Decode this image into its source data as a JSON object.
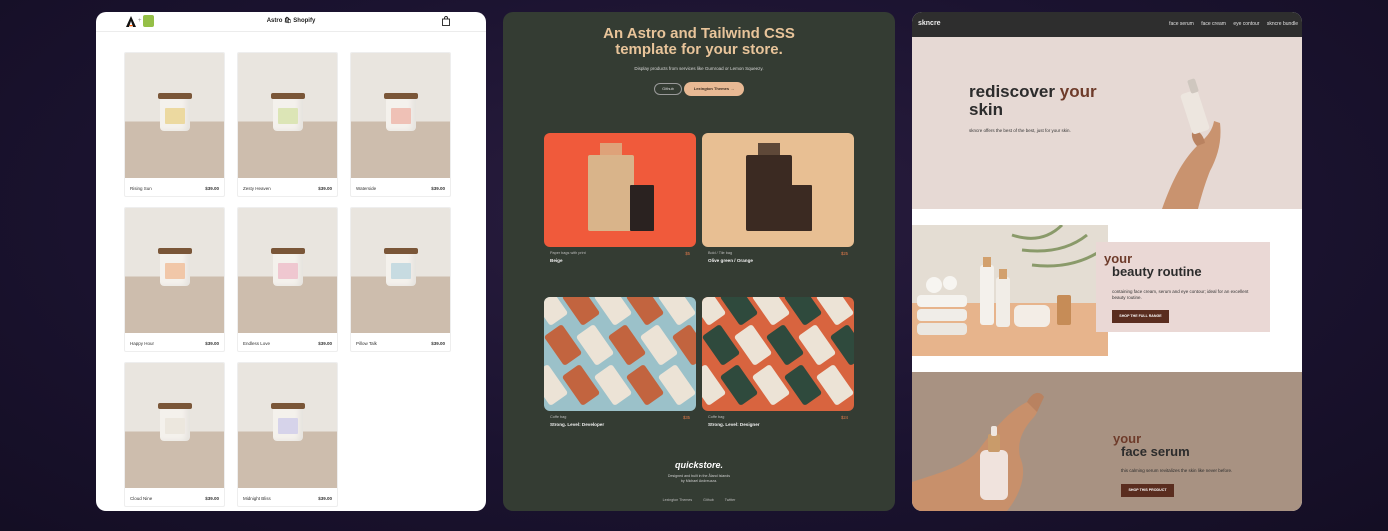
{
  "astro_shopify": {
    "header_title": "Astro 🛍 Shopify",
    "products": [
      {
        "name": "Rising Sun",
        "price": "$39.00",
        "label_color": "#ecd9a0"
      },
      {
        "name": "Zesty Heaven",
        "price": "$39.00",
        "label_color": "#dce5b6"
      },
      {
        "name": "Waterside",
        "price": "$39.00",
        "label_color": "#efc1b6"
      },
      {
        "name": "Happy Hour",
        "price": "$39.00",
        "label_color": "#f1c7a8"
      },
      {
        "name": "Endless Love",
        "price": "$39.00",
        "label_color": "#efc7d0"
      },
      {
        "name": "Pillow Talk",
        "price": "$39.00",
        "label_color": "#c7dbe1"
      },
      {
        "name": "Cloud Nine",
        "price": "$39.00",
        "label_color": "#ece7de"
      },
      {
        "name": "Midnight Bliss",
        "price": "$39.00",
        "label_color": "#d6d3ea"
      }
    ]
  },
  "quickstore": {
    "hero_title_line1": "An Astro and Tailwind CSS",
    "hero_title_line2": "template for your store.",
    "hero_subtitle": "Display products from services like Gumroad or Lemon Squeezy.",
    "github_button": "Github",
    "lexington_button": "Lexington Themes →",
    "products": [
      {
        "category": "Paper bags with print",
        "name": "Beige",
        "price": "$5",
        "colors": [
          "#f05a3b",
          "#d9b48a"
        ]
      },
      {
        "category": "Bold / Tile bag",
        "name": "Olive green / Orange",
        "price": "$25",
        "colors": [
          "#e8bf93",
          "#3b2a22"
        ]
      },
      {
        "category": "Coffe bag",
        "name": "Strong. Level: Developer",
        "price": "$35",
        "colors": [
          "#9bc1c9",
          "#c2643f"
        ]
      },
      {
        "category": "Coffe bag",
        "name": "Strong. Level: Designer",
        "price": "$24",
        "colors": [
          "#d8643f",
          "#2f4a3d"
        ]
      }
    ],
    "brand": "quickstore.",
    "credit_line1": "Designed and built in the Åland Islands",
    "credit_line2": "by Michael Andreuzza.",
    "footer_links": [
      "Lexington Themes",
      "Github",
      "Twitter"
    ]
  },
  "skncre": {
    "logo": "skncre",
    "nav_links": [
      "face serum",
      "face cream",
      "eye contour",
      "skncre bundle"
    ],
    "hero_title_part1": "rediscover",
    "hero_title_part2": "your",
    "hero_title_part3": "skin",
    "hero_subtitle": "skncre offers the best of the best, just for your skin.",
    "routine_title_accent": "your",
    "routine_title": "beauty routine",
    "routine_text": "containing face cream, serum and eye contour; ideal for an excellent beauty routine.",
    "routine_cta": "SHOP THE FULL RANGE",
    "serum_title_accent": "your",
    "serum_title": "face serum",
    "serum_text": "this calming serum revitalizes the skin like never before.",
    "serum_cta": "SHOP THIS PRODUCT"
  }
}
